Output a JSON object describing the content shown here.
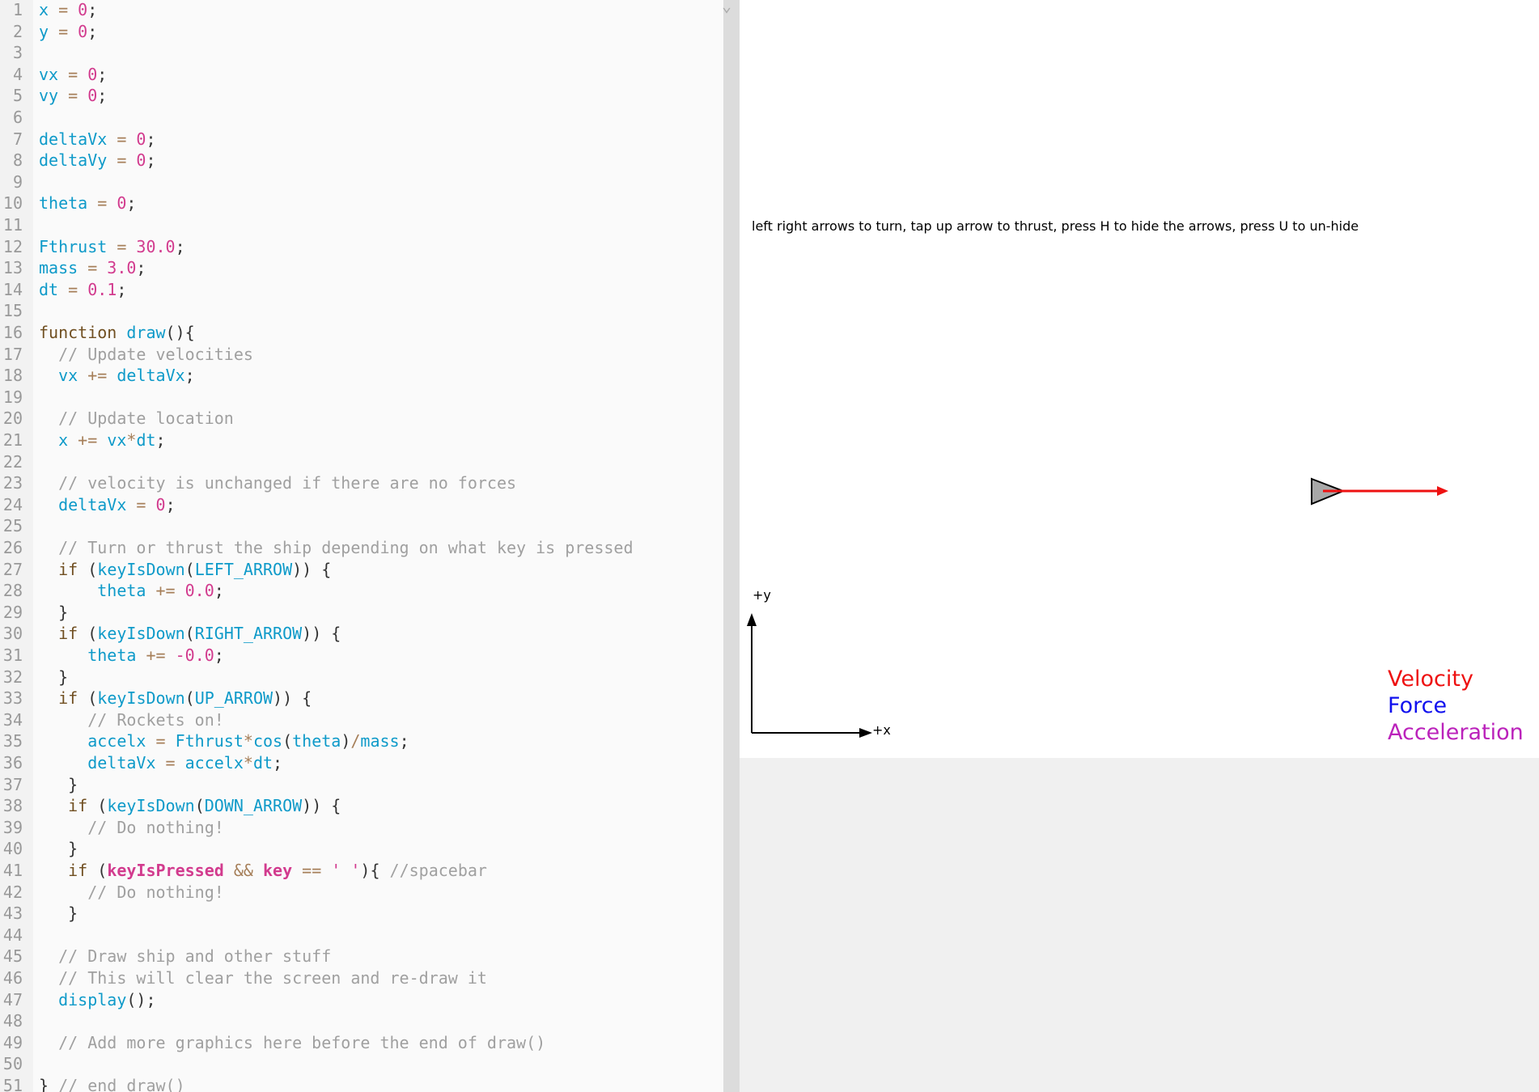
{
  "editor": {
    "lines": [
      {
        "n": "1",
        "t": [
          [
            "v",
            "x"
          ],
          [
            "o",
            " = "
          ],
          [
            "n",
            "0"
          ],
          [
            "p",
            ";"
          ]
        ]
      },
      {
        "n": "2",
        "t": [
          [
            "v",
            "y"
          ],
          [
            "o",
            " = "
          ],
          [
            "n",
            "0"
          ],
          [
            "p",
            ";"
          ]
        ]
      },
      {
        "n": "3",
        "t": []
      },
      {
        "n": "4",
        "t": [
          [
            "v",
            "vx"
          ],
          [
            "o",
            " = "
          ],
          [
            "n",
            "0"
          ],
          [
            "p",
            ";"
          ]
        ]
      },
      {
        "n": "5",
        "t": [
          [
            "v",
            "vy"
          ],
          [
            "o",
            " = "
          ],
          [
            "n",
            "0"
          ],
          [
            "p",
            ";"
          ]
        ]
      },
      {
        "n": "6",
        "t": []
      },
      {
        "n": "7",
        "t": [
          [
            "v",
            "deltaVx"
          ],
          [
            "o",
            " = "
          ],
          [
            "n",
            "0"
          ],
          [
            "p",
            ";"
          ]
        ]
      },
      {
        "n": "8",
        "t": [
          [
            "v",
            "deltaVy"
          ],
          [
            "o",
            " = "
          ],
          [
            "n",
            "0"
          ],
          [
            "p",
            ";"
          ]
        ]
      },
      {
        "n": "9",
        "t": []
      },
      {
        "n": "10",
        "t": [
          [
            "v",
            "theta"
          ],
          [
            "o",
            " = "
          ],
          [
            "n",
            "0"
          ],
          [
            "p",
            ";"
          ]
        ]
      },
      {
        "n": "11",
        "t": []
      },
      {
        "n": "12",
        "t": [
          [
            "v",
            "Fthrust"
          ],
          [
            "o",
            " = "
          ],
          [
            "n",
            "30.0"
          ],
          [
            "p",
            ";"
          ]
        ]
      },
      {
        "n": "13",
        "t": [
          [
            "v",
            "mass"
          ],
          [
            "o",
            " = "
          ],
          [
            "n",
            "3.0"
          ],
          [
            "p",
            ";"
          ]
        ]
      },
      {
        "n": "14",
        "t": [
          [
            "v",
            "dt"
          ],
          [
            "o",
            " = "
          ],
          [
            "n",
            "0.1"
          ],
          [
            "p",
            ";"
          ]
        ]
      },
      {
        "n": "15",
        "t": []
      },
      {
        "n": "16",
        "t": [
          [
            "k",
            "function "
          ],
          [
            "v",
            "draw"
          ],
          [
            "p",
            "(){"
          ]
        ]
      },
      {
        "n": "17",
        "t": [
          [
            "p",
            "  "
          ],
          [
            "c",
            "// Update velocities"
          ]
        ]
      },
      {
        "n": "18",
        "t": [
          [
            "p",
            "  "
          ],
          [
            "v",
            "vx"
          ],
          [
            "o",
            " += "
          ],
          [
            "v",
            "deltaVx"
          ],
          [
            "p",
            ";"
          ]
        ]
      },
      {
        "n": "19",
        "t": []
      },
      {
        "n": "20",
        "t": [
          [
            "p",
            "  "
          ],
          [
            "c",
            "// Update location"
          ]
        ]
      },
      {
        "n": "21",
        "t": [
          [
            "p",
            "  "
          ],
          [
            "v",
            "x"
          ],
          [
            "o",
            " += "
          ],
          [
            "v",
            "vx"
          ],
          [
            "o",
            "*"
          ],
          [
            "v",
            "dt"
          ],
          [
            "p",
            ";"
          ]
        ]
      },
      {
        "n": "22",
        "t": []
      },
      {
        "n": "23",
        "t": [
          [
            "p",
            "  "
          ],
          [
            "c",
            "// velocity is unchanged if there are no forces"
          ]
        ]
      },
      {
        "n": "24",
        "t": [
          [
            "p",
            "  "
          ],
          [
            "v",
            "deltaVx"
          ],
          [
            "o",
            " = "
          ],
          [
            "n",
            "0"
          ],
          [
            "p",
            ";"
          ]
        ]
      },
      {
        "n": "25",
        "t": []
      },
      {
        "n": "26",
        "t": [
          [
            "p",
            "  "
          ],
          [
            "c",
            "// Turn or thrust the ship depending on what key is pressed"
          ]
        ]
      },
      {
        "n": "27",
        "t": [
          [
            "p",
            "  "
          ],
          [
            "k",
            "if"
          ],
          [
            "p",
            " ("
          ],
          [
            "v",
            "keyIsDown"
          ],
          [
            "p",
            "("
          ],
          [
            "v",
            "LEFT_ARROW"
          ],
          [
            "p",
            ")) {"
          ]
        ]
      },
      {
        "n": "28",
        "t": [
          [
            "p",
            "      "
          ],
          [
            "v",
            "theta"
          ],
          [
            "o",
            " += "
          ],
          [
            "n",
            "0.0"
          ],
          [
            "p",
            ";"
          ]
        ]
      },
      {
        "n": "29",
        "t": [
          [
            "p",
            "  }"
          ]
        ]
      },
      {
        "n": "30",
        "t": [
          [
            "p",
            "  "
          ],
          [
            "k",
            "if"
          ],
          [
            "p",
            " ("
          ],
          [
            "v",
            "keyIsDown"
          ],
          [
            "p",
            "("
          ],
          [
            "v",
            "RIGHT_ARROW"
          ],
          [
            "p",
            ")) {"
          ]
        ]
      },
      {
        "n": "31",
        "t": [
          [
            "p",
            "     "
          ],
          [
            "v",
            "theta"
          ],
          [
            "o",
            " += "
          ],
          [
            "n",
            "-0.0"
          ],
          [
            "p",
            ";"
          ]
        ]
      },
      {
        "n": "32",
        "t": [
          [
            "p",
            "  }"
          ]
        ]
      },
      {
        "n": "33",
        "t": [
          [
            "p",
            "  "
          ],
          [
            "k",
            "if"
          ],
          [
            "p",
            " ("
          ],
          [
            "v",
            "keyIsDown"
          ],
          [
            "p",
            "("
          ],
          [
            "v",
            "UP_ARROW"
          ],
          [
            "p",
            ")) {"
          ]
        ]
      },
      {
        "n": "34",
        "t": [
          [
            "p",
            "     "
          ],
          [
            "c",
            "// Rockets on!"
          ]
        ]
      },
      {
        "n": "35",
        "t": [
          [
            "p",
            "     "
          ],
          [
            "v",
            "accelx"
          ],
          [
            "o",
            " = "
          ],
          [
            "v",
            "Fthrust"
          ],
          [
            "o",
            "*"
          ],
          [
            "v",
            "cos"
          ],
          [
            "p",
            "("
          ],
          [
            "v",
            "theta"
          ],
          [
            "p",
            ")"
          ],
          [
            "o",
            "/"
          ],
          [
            "v",
            "mass"
          ],
          [
            "p",
            ";"
          ]
        ]
      },
      {
        "n": "36",
        "t": [
          [
            "p",
            "     "
          ],
          [
            "v",
            "deltaVx"
          ],
          [
            "o",
            " = "
          ],
          [
            "v",
            "accelx"
          ],
          [
            "o",
            "*"
          ],
          [
            "v",
            "dt"
          ],
          [
            "p",
            ";"
          ]
        ]
      },
      {
        "n": "37",
        "t": [
          [
            "p",
            "   }"
          ]
        ]
      },
      {
        "n": "38",
        "t": [
          [
            "p",
            "   "
          ],
          [
            "k",
            "if"
          ],
          [
            "p",
            " ("
          ],
          [
            "v",
            "keyIsDown"
          ],
          [
            "p",
            "("
          ],
          [
            "v",
            "DOWN_ARROW"
          ],
          [
            "p",
            ")) {"
          ]
        ]
      },
      {
        "n": "39",
        "t": [
          [
            "p",
            "     "
          ],
          [
            "c",
            "// Do nothing!"
          ]
        ]
      },
      {
        "n": "40",
        "t": [
          [
            "p",
            "   }"
          ]
        ]
      },
      {
        "n": "41",
        "t": [
          [
            "p",
            "   "
          ],
          [
            "k",
            "if"
          ],
          [
            "p",
            " ("
          ],
          [
            "b",
            "keyIsPressed"
          ],
          [
            "o",
            " && "
          ],
          [
            "b",
            "key"
          ],
          [
            "o",
            " == "
          ],
          [
            "n",
            "' '"
          ],
          [
            "p",
            "){ "
          ],
          [
            "c",
            "//spacebar"
          ]
        ]
      },
      {
        "n": "42",
        "t": [
          [
            "p",
            "     "
          ],
          [
            "c",
            "// Do nothing!"
          ]
        ]
      },
      {
        "n": "43",
        "t": [
          [
            "p",
            "   }"
          ]
        ]
      },
      {
        "n": "44",
        "t": []
      },
      {
        "n": "45",
        "t": [
          [
            "p",
            "  "
          ],
          [
            "c",
            "// Draw ship and other stuff"
          ]
        ]
      },
      {
        "n": "46",
        "t": [
          [
            "p",
            "  "
          ],
          [
            "c",
            "// This will clear the screen and re-draw it"
          ]
        ]
      },
      {
        "n": "47",
        "t": [
          [
            "p",
            "  "
          ],
          [
            "v",
            "display"
          ],
          [
            "p",
            "();"
          ]
        ]
      },
      {
        "n": "48",
        "t": []
      },
      {
        "n": "49",
        "t": [
          [
            "p",
            "  "
          ],
          [
            "c",
            "// Add more graphics here before the end of draw()"
          ]
        ]
      },
      {
        "n": "50",
        "t": []
      },
      {
        "n": "51",
        "t": [
          [
            "p",
            "} "
          ],
          [
            "c",
            "// end draw()"
          ]
        ]
      }
    ]
  },
  "sketch": {
    "instructions": "left right arrows to turn, tap up arrow to thrust, press H to hide the arrows, press U to un-hide",
    "axes": {
      "x_label": "+x",
      "y_label": "+y"
    },
    "legend": [
      {
        "label": "Velocity",
        "color": "#ee1111"
      },
      {
        "label": "Force",
        "color": "#1111ee"
      },
      {
        "label": "Acceleration",
        "color": "#bb22bb"
      }
    ],
    "ship_fill": "#a8a8a8",
    "velocity_arrow_color": "#ee1111"
  },
  "icons": {
    "collapse": "chevron-down-icon"
  }
}
